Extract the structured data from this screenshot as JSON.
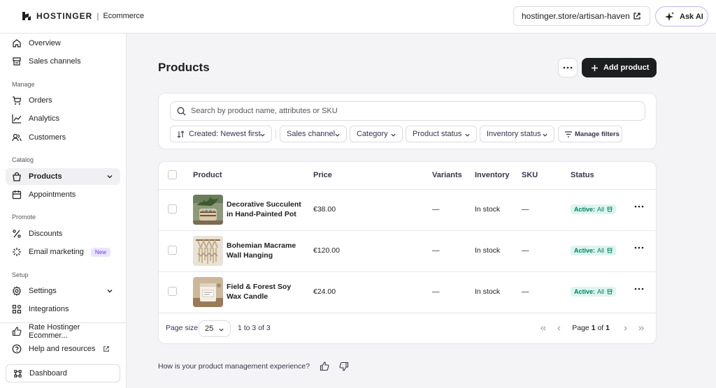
{
  "header": {
    "brand": "HOSTINGER",
    "separator": "|",
    "product": "Ecommerce",
    "store_url": "hostinger.store/artisan-haven",
    "ask_ai": "Ask AI"
  },
  "sidebar": {
    "top_items": [
      {
        "label": "Overview",
        "icon": "home-icon"
      },
      {
        "label": "Sales channels",
        "icon": "store-icon"
      }
    ],
    "sections": [
      {
        "label": "Manage",
        "items": [
          {
            "label": "Orders",
            "icon": "cart-icon"
          },
          {
            "label": "Analytics",
            "icon": "chart-icon"
          },
          {
            "label": "Customers",
            "icon": "users-icon"
          }
        ]
      },
      {
        "label": "Catalog",
        "items": [
          {
            "label": "Products",
            "icon": "bag-icon",
            "active": true
          },
          {
            "label": "Appointments",
            "icon": "calendar-icon"
          }
        ]
      },
      {
        "label": "Promote",
        "items": [
          {
            "label": "Discounts",
            "icon": "percent-icon"
          },
          {
            "label": "Email marketing",
            "icon": "sparkle-icon",
            "badge": "New"
          }
        ]
      },
      {
        "label": "Setup",
        "items": [
          {
            "label": "Settings",
            "icon": "gear-icon"
          },
          {
            "label": "Integrations",
            "icon": "grid-icon"
          }
        ]
      }
    ],
    "bottom_items": [
      {
        "label": "Rate Hostinger Ecommer...",
        "icon": "thumb-up-icon"
      },
      {
        "label": "Help and resources",
        "icon": "help-icon"
      }
    ],
    "dashboard": "Dashboard"
  },
  "main": {
    "title": "Products",
    "add_product": "Add product",
    "search_placeholder": "Search by product name, attributes or SKU",
    "filters": {
      "sort": "Created: Newest first",
      "sales_channel": "Sales channel",
      "category": "Category",
      "product_status": "Product status",
      "inventory_status": "Inventory status",
      "manage_filters": "Manage filters"
    },
    "table": {
      "columns": {
        "product": "Product",
        "price": "Price",
        "variants": "Variants",
        "inventory": "Inventory",
        "sku": "SKU",
        "status": "Status"
      },
      "rows": [
        {
          "name": "Decorative Succulent in Hand-Painted Pot",
          "price": "€38.00",
          "variants": "—",
          "inventory": "In stock",
          "sku": "—",
          "status_label": "Active:",
          "status_value": "All"
        },
        {
          "name": "Bohemian Macrame Wall Hanging",
          "price": "€120.00",
          "variants": "—",
          "inventory": "In stock",
          "sku": "—",
          "status_label": "Active:",
          "status_value": "All"
        },
        {
          "name": "Field & Forest Soy Wax Candle",
          "price": "€24.00",
          "variants": "—",
          "inventory": "In stock",
          "sku": "—",
          "status_label": "Active:",
          "status_value": "All"
        }
      ]
    },
    "pagination": {
      "page_size_label": "Page size",
      "page_size": "25",
      "range": "1 to 3 of 3",
      "page_prefix": "Page",
      "current_page": "1",
      "of": "of",
      "total_pages": "1"
    },
    "feedback": "How is your product management experience?"
  }
}
